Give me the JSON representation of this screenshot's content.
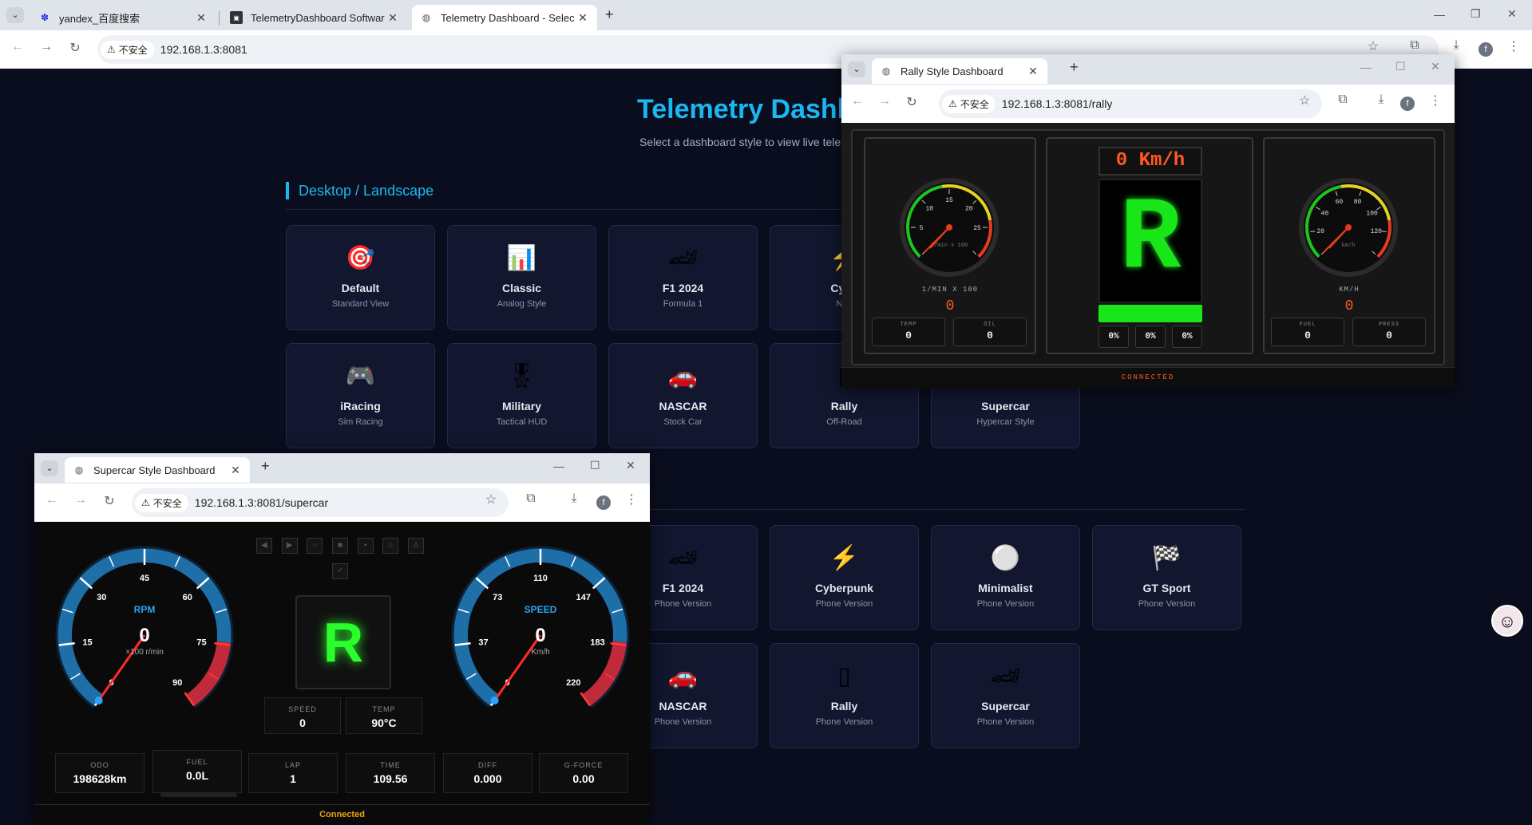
{
  "browser": {
    "tabs": [
      {
        "title": "yandex_百度搜索",
        "icon": "baidu-icon"
      },
      {
        "title": "TelemetryDashboard Softwar",
        "icon": "app-icon"
      },
      {
        "title": "Telemetry Dashboard - Selec",
        "icon": "globe-icon"
      }
    ],
    "security_label": "不安全",
    "url": "192.168.1.3:8081",
    "profile_initial": "f"
  },
  "page": {
    "title": "Telemetry Dashbo",
    "subtitle": "Select a dashboard style to view live teler",
    "desktop_section": "Desktop / Landscape",
    "desktop_cards": [
      {
        "name": "Default",
        "sub": "Standard View",
        "icon": "🎯"
      },
      {
        "name": "Classic",
        "sub": "Analog Style",
        "icon": "📊"
      },
      {
        "name": "F1 2024",
        "sub": "Formula 1",
        "icon": "🏎"
      },
      {
        "name": "Cybe",
        "sub": "Neo",
        "icon": "⚡"
      },
      {
        "name": "iRacing",
        "sub": "Sim Racing",
        "icon": "🎮"
      },
      {
        "name": "Military",
        "sub": "Tactical HUD",
        "icon": "🎖"
      },
      {
        "name": "NASCAR",
        "sub": "Stock Car",
        "icon": "🚗"
      },
      {
        "name": "Rally",
        "sub": "Off-Road",
        "icon": "▯"
      },
      {
        "name": "Supercar",
        "sub": "Hypercar Style",
        "icon": "🏎"
      }
    ],
    "phone_cards": [
      {
        "name": "F1 2024",
        "sub": "Phone Version",
        "icon": "🏎"
      },
      {
        "name": "Cyberpunk",
        "sub": "Phone Version",
        "icon": "⚡"
      },
      {
        "name": "Minimalist",
        "sub": "Phone Version",
        "icon": "⚪"
      },
      {
        "name": "GT Sport",
        "sub": "Phone Version",
        "icon": "🏁"
      },
      {
        "name": "NASCAR",
        "sub": "Phone Version",
        "icon": "🚗"
      },
      {
        "name": "Rally",
        "sub": "Phone Version",
        "icon": "▯"
      },
      {
        "name": "Supercar",
        "sub": "Phone Version",
        "icon": "🏎"
      }
    ]
  },
  "rally_window": {
    "tab_title": "Rally Style Dashboard",
    "security_label": "不安全",
    "url": "192.168.1.3:8081/rally",
    "speed_display": "0 Km/h",
    "gear": "R",
    "rpm": {
      "ticks": [
        "5",
        "10",
        "15",
        "20",
        "25"
      ],
      "inner_label": "1/min x 100",
      "label": "1/MIN X 100",
      "value": "0"
    },
    "speed": {
      "ticks": [
        "20",
        "40",
        "60",
        "80",
        "100",
        "120"
      ],
      "inner_label": "km/h",
      "label": "KM/H",
      "value": "0"
    },
    "left_boxes": [
      {
        "label": "TEMP",
        "value": "0"
      },
      {
        "label": "OIL",
        "value": "0"
      }
    ],
    "right_boxes": [
      {
        "label": "FUEL",
        "value": "0"
      },
      {
        "label": "PRESS",
        "value": "0"
      }
    ],
    "percent_boxes": [
      "0%",
      "0%",
      "0%"
    ],
    "status": "CONNECTED",
    "colors": {
      "accent": "#ff5a1f",
      "gear": "#19e619"
    }
  },
  "supercar_window": {
    "tab_title": "Supercar Style Dashboard",
    "security_label": "不安全",
    "url": "192.168.1.3:8081/supercar",
    "gear": "R",
    "rpm": {
      "label": "RPM",
      "value": "0",
      "unit": "×100 r/min",
      "ticks": [
        "0",
        "15",
        "30",
        "45",
        "60",
        "75",
        "90"
      ]
    },
    "speed": {
      "label": "SPEED",
      "value": "0",
      "unit": "Km/h",
      "ticks": [
        "0",
        "37",
        "73",
        "110",
        "147",
        "183",
        "220"
      ]
    },
    "mid_boxes": [
      {
        "label": "SPEED",
        "value": "0"
      },
      {
        "label": "TEMP",
        "value": "90°C"
      }
    ],
    "bottom_boxes": [
      {
        "label": "ODO",
        "value": "198628km"
      },
      {
        "label": "FUEL",
        "value": "0.0L"
      },
      {
        "label": "LAP",
        "value": "1"
      },
      {
        "label": "TIME",
        "value": "109.56"
      },
      {
        "label": "DIFF",
        "value": "0.000"
      },
      {
        "label": "G-FORCE",
        "value": "0.00"
      }
    ],
    "status": "Connected",
    "colors": {
      "gear": "#2bff2b",
      "gauge_blue": "#1e6ea8",
      "redline": "#c02a3a"
    }
  }
}
